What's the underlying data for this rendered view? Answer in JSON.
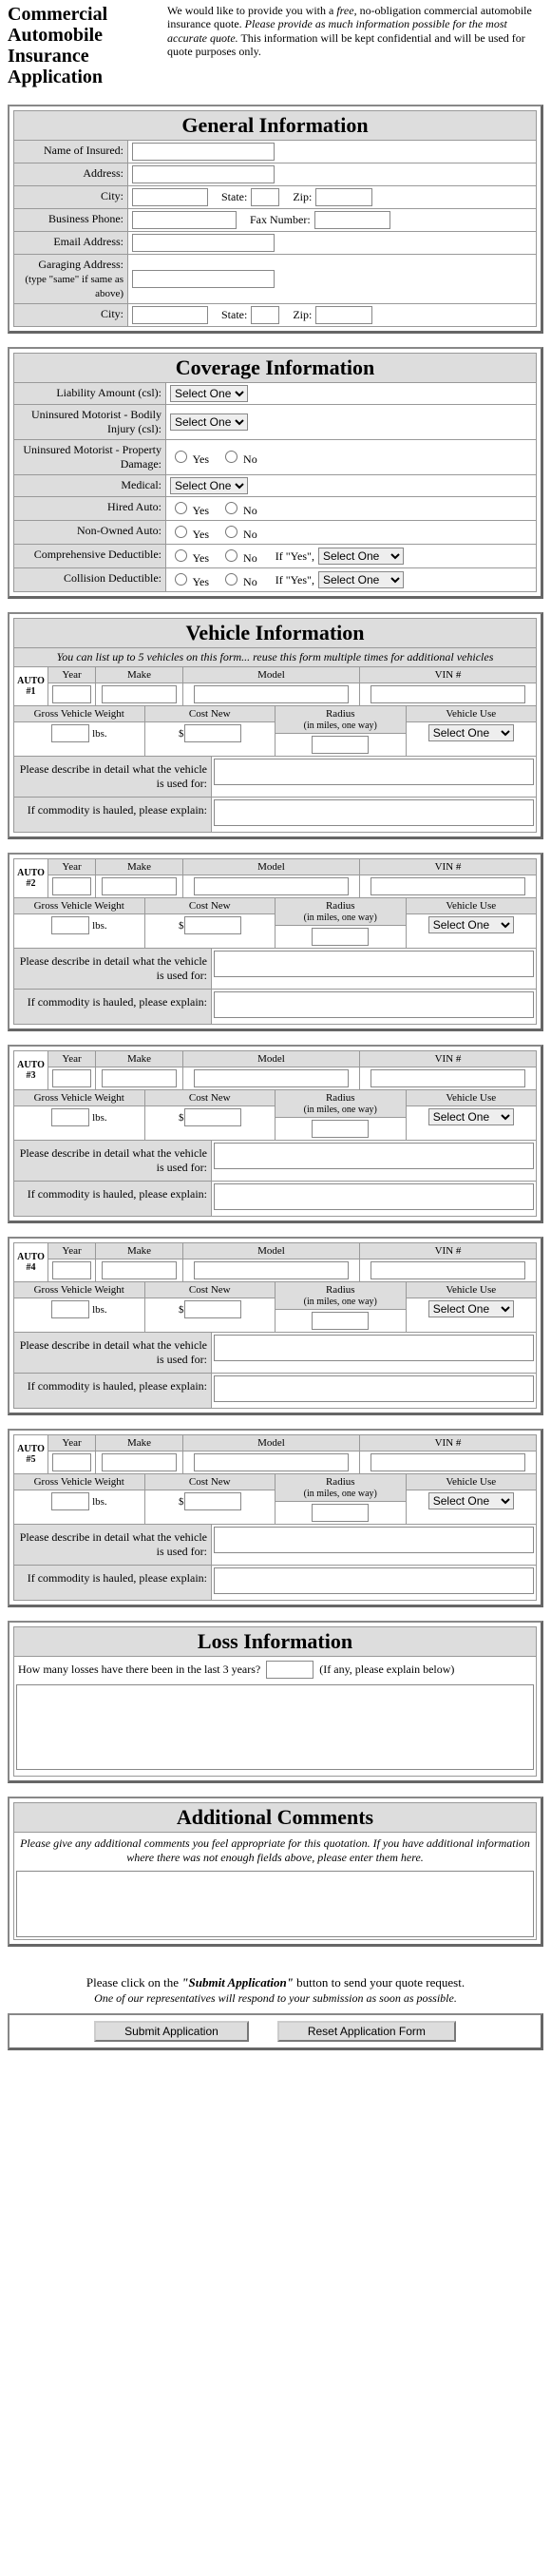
{
  "header": {
    "title_l1": "Commercial",
    "title_l2": "Automobile",
    "title_l3": "Insurance Application",
    "intro_pre": "We would like to provide you with a ",
    "intro_free": "free",
    "intro_mid": ", no-obligation commercial automobile insurance quote. ",
    "intro_provide": "Please provide as much information possible for the most accurate quote.",
    "intro_post": " This information will be kept confidential and will be used for quote purposes only."
  },
  "general": {
    "title": "General Information",
    "name_label": "Name of Insured:",
    "address_label": "Address:",
    "city_label": "City:",
    "state_label": "State:",
    "zip_label": "Zip:",
    "bphone_label": "Business Phone:",
    "fax_label": "Fax Number:",
    "email_label": "Email Address:",
    "garage_label": "Garaging Address:",
    "garage_sub": "(type \"same\" if same as above)",
    "city2_label": "City:"
  },
  "coverage": {
    "title": "Coverage Information",
    "liability_label": "Liability Amount (csl):",
    "uninsured_bi_label": "Uninsured Motorist - Bodily Injury (csl):",
    "uninsured_pd_label": "Uninsured Motorist - Property Damage:",
    "medical_label": "Medical:",
    "hired_label": "Hired Auto:",
    "nonowned_label": "Non-Owned Auto:",
    "comp_label": "Comprehensive Deductible:",
    "coll_label": "Collision Deductible:",
    "select_one": "Select One",
    "yes": "Yes",
    "no": "No",
    "if_yes": "If \"Yes\","
  },
  "vehicle": {
    "title": "Vehicle Information",
    "note": "You can list up to 5 vehicles on this form... reuse this form multiple times for additional vehicles",
    "year": "Year",
    "make": "Make",
    "model": "Model",
    "vin": "VIN #",
    "gvw": "Gross Vehicle Weight",
    "costnew": "Cost New",
    "radius": "Radius",
    "radius_sub": "(in miles, one way)",
    "use": "Vehicle Use",
    "lbs": "lbs.",
    "dollar": "$",
    "select_one": "Select One",
    "describe": "Please describe in detail what the vehicle is used for:",
    "commodity": "If commodity is hauled, please explain:",
    "autos": [
      "AUTO #1",
      "AUTO #2",
      "AUTO #3",
      "AUTO #4",
      "AUTO #5"
    ]
  },
  "loss": {
    "title": "Loss Information",
    "q": "How many losses have there been in the last 3 years?",
    "after": "(If any, please explain below)"
  },
  "comments": {
    "title": "Additional Comments",
    "note": "Please give any additional comments you feel appropriate for this quotation. If you have additional information where there was not enough fields above, please enter them here."
  },
  "submit": {
    "pre": "Please click on the ",
    "btn_text": "\"Submit Application\"",
    "post": " button to send your quote request.",
    "sub": "One of our representatives will respond to your submission as soon as possible.",
    "submit_btn": "Submit Application",
    "reset_btn": "Reset Application Form"
  }
}
